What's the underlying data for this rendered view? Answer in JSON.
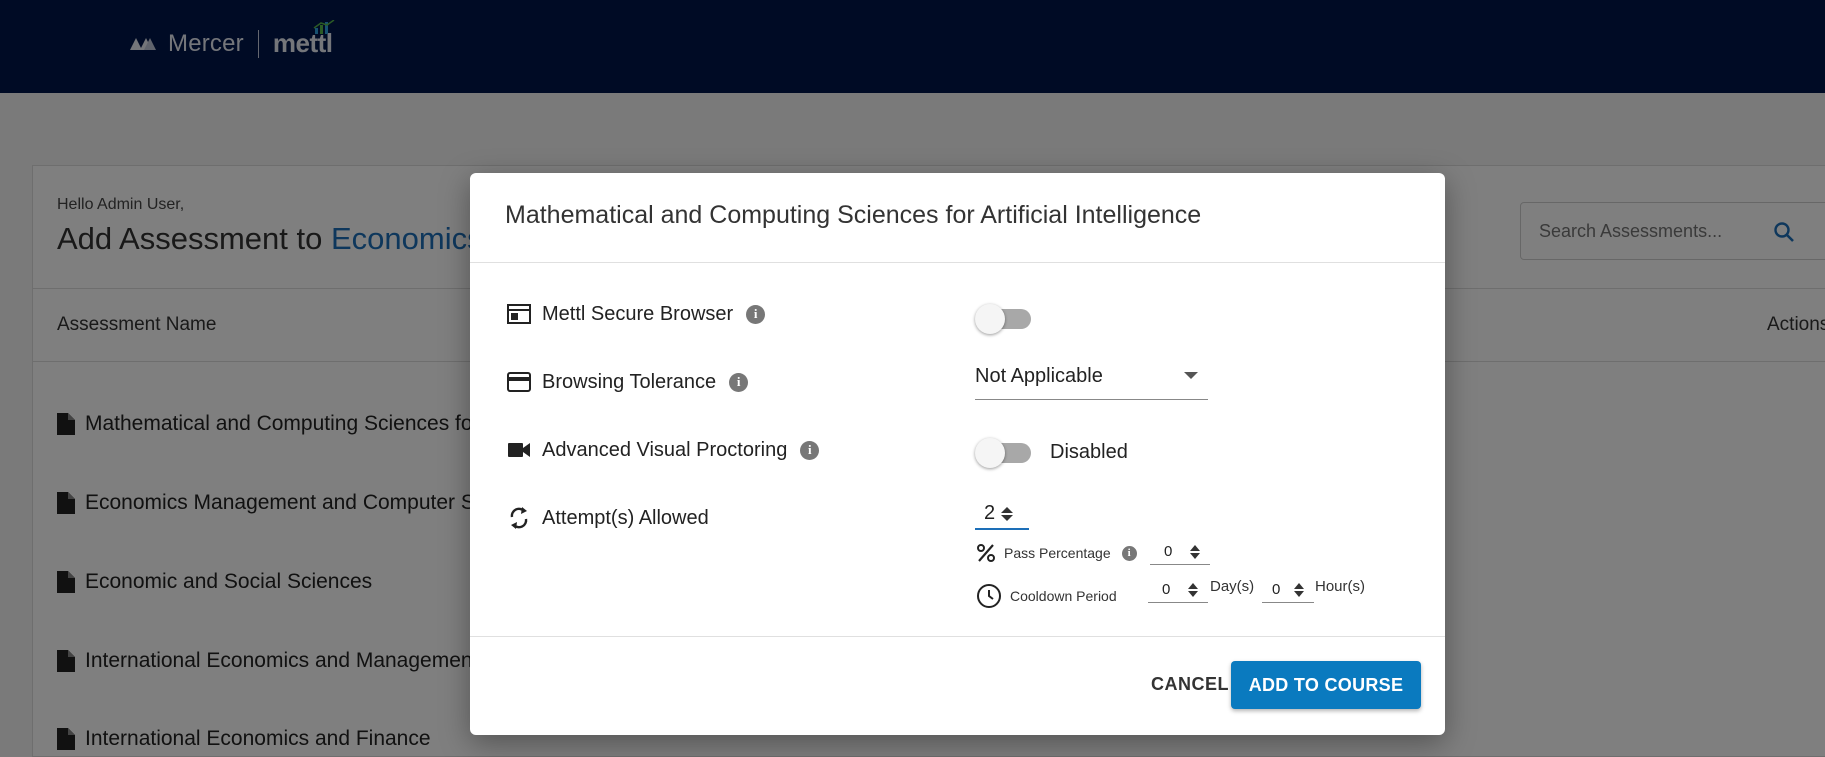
{
  "header": {
    "brand": "Mercer",
    "product": "mettl"
  },
  "page": {
    "greeting": "Hello Admin User,",
    "title_prefix": "Add Assessment to ",
    "title_course": "Economics",
    "search_placeholder": "Search Assessments...",
    "column_name": "Assessment Name",
    "column_actions": "Actions",
    "assessments": [
      "Mathematical and Computing Sciences fo",
      "Economics Management and Computer S",
      "Economic and Social Sciences",
      "International Economics and Managemen",
      "International Economics and Finance"
    ]
  },
  "modal": {
    "title": "Mathematical and Computing Sciences for Artificial Intelligence",
    "secure_browser_label": "Mettl Secure Browser",
    "browsing_tolerance_label": "Browsing Tolerance",
    "browsing_tolerance_value": "Not Applicable",
    "visual_proctoring_label": "Advanced Visual Proctoring",
    "visual_proctoring_status": "Disabled",
    "attempts_label": "Attempt(s) Allowed",
    "attempts_value": "2",
    "pass_percentage_label": "Pass Percentage",
    "pass_percentage_value": "0",
    "cooldown_label": "Cooldown Period",
    "cooldown_days_value": "0",
    "cooldown_days_unit": "Day(s)",
    "cooldown_hours_value": "0",
    "cooldown_hours_unit": "Hour(s)",
    "cancel_label": "CANCEL",
    "add_label": "ADD TO COURSE"
  },
  "colors": {
    "header_bg": "#00164a",
    "accent": "#0a7abf",
    "link": "#1d6fb8"
  }
}
